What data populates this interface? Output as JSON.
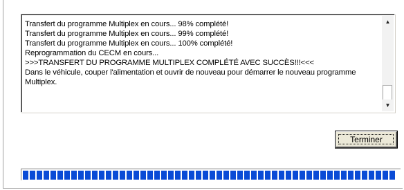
{
  "log": {
    "lines": [
      "Transfert du programme Multiplex en cours... 98% complété!",
      "Transfert du programme Multiplex en cours... 99% complété!",
      "Transfert du programme Multiplex en cours... 100% complété!",
      "Reprogrammation du CECM en cours...",
      ">>>TRANSFERT DU PROGRAMME MULTIPLEX COMPLÉTÉ AVEC SUCCÈS!!!<<<",
      "Dans le véhicule, couper l'alimentation et ouvrir de nouveau pour démarrer le nouveau programme Multiplex."
    ]
  },
  "scrollbar": {
    "up_icon": "arrow-up-icon",
    "down_icon": "arrow-down-icon"
  },
  "buttons": {
    "finish_label": "Terminer"
  },
  "progress": {
    "fraction": 1.0,
    "color": "#0a4bd6"
  }
}
